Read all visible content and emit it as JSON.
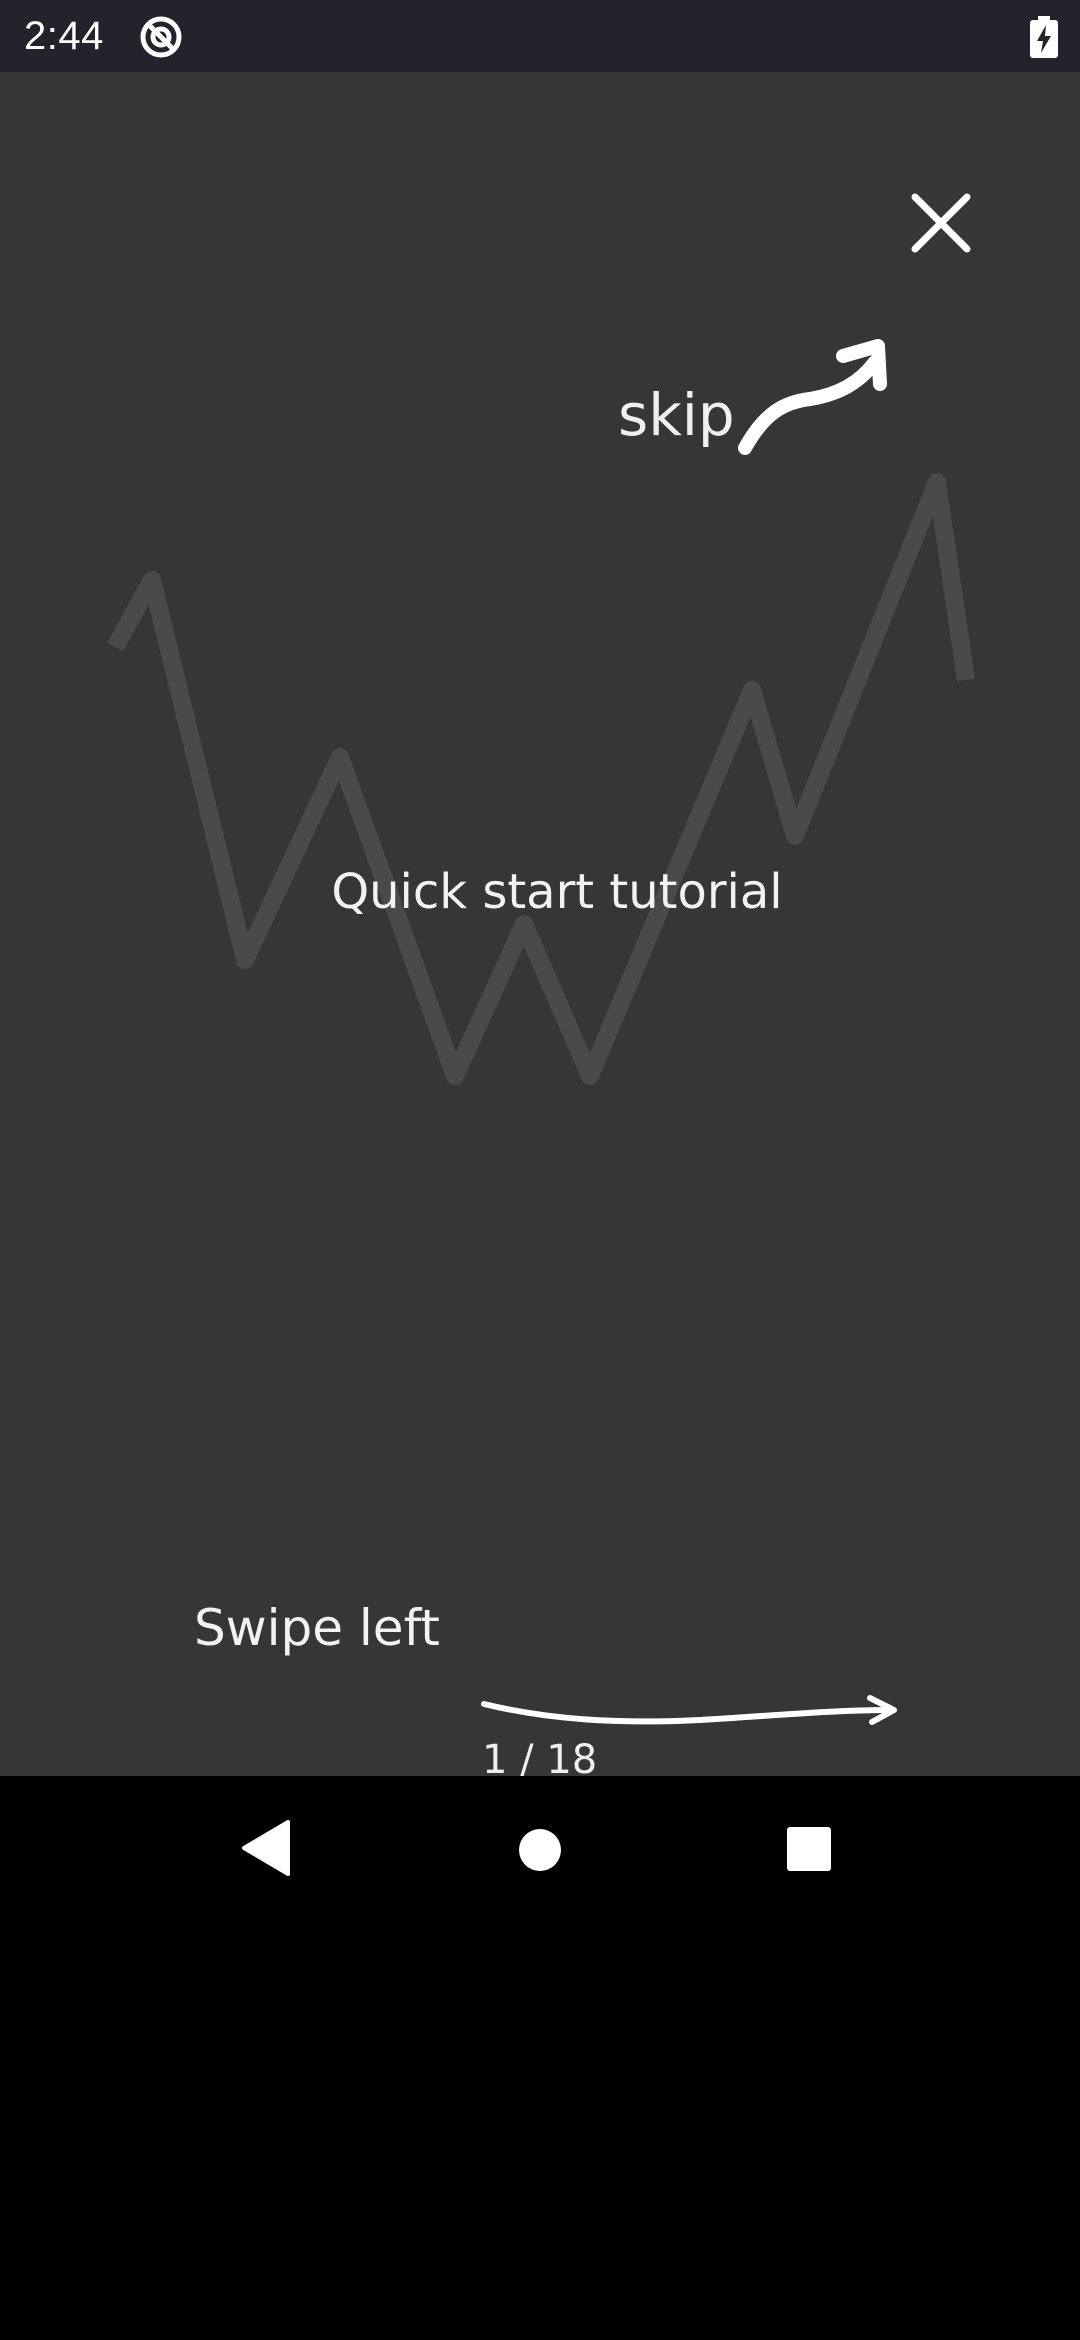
{
  "status_bar": {
    "time": "2:44",
    "app_icon": "at-sign-circle-icon",
    "battery_icon": "battery-charging-icon"
  },
  "tutorial": {
    "close_icon": "close-icon",
    "skip_label": "skip",
    "skip_arrow_icon": "curved-arrow-up-right-icon",
    "title": "Quick start tutorial",
    "swipe_label": "Swipe left",
    "swipe_arrow_icon": "arrow-right-icon",
    "page_indicator": "1 / 18",
    "background_decoration": "zigzag-line-icon"
  },
  "nav_bar": {
    "back_icon": "back-triangle-icon",
    "home_icon": "home-circle-icon",
    "recents_icon": "recents-square-icon"
  },
  "colors": {
    "status_bar_bg": "#22232d",
    "screen_bg": "#363636",
    "decoration_line": "#4a4a4a",
    "foreground": "#ffffff",
    "nav_bar_bg": "#000000"
  }
}
